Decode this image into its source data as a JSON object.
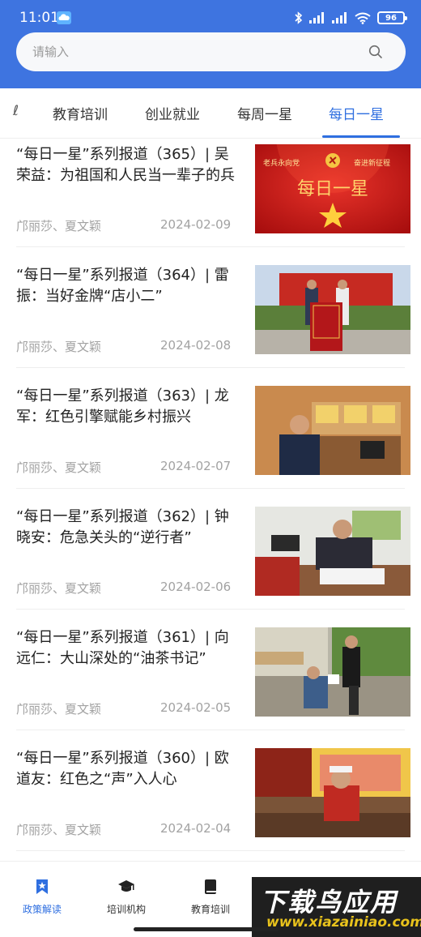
{
  "status": {
    "time": "11:01",
    "battery": "96"
  },
  "search": {
    "placeholder": "请输入",
    "value": ""
  },
  "tabs": [
    {
      "label": "ℓ",
      "active": false
    },
    {
      "label": "教育培训",
      "active": false
    },
    {
      "label": "创业就业",
      "active": false
    },
    {
      "label": "每周一星",
      "active": false
    },
    {
      "label": "每日一星",
      "active": true
    }
  ],
  "articles": [
    {
      "title": "“每日一星”系列报道（365）| 吴荣益：为祖国和人民当一辈子的兵",
      "author": "邝丽莎、夏文颖",
      "date": "2024-02-09",
      "thumb": {
        "banner_left": "老兵永向党",
        "banner_right": "奋进新征程",
        "headline": "每日一星"
      }
    },
    {
      "title": "“每日一星”系列报道（364）| 雷振：当好金牌“店小二”",
      "author": "邝丽莎、夏文颖",
      "date": "2024-02-08"
    },
    {
      "title": "“每日一星”系列报道（363）| 龙军：红色引擎赋能乡村振兴",
      "author": "邝丽莎、夏文颖",
      "date": "2024-02-07"
    },
    {
      "title": "“每日一星”系列报道（362）| 钟晓安：危急关头的“逆行者”",
      "author": "邝丽莎、夏文颖",
      "date": "2024-02-06"
    },
    {
      "title": "“每日一星”系列报道（361）| 向远仁：大山深处的“油茶书记”",
      "author": "邝丽莎、夏文颖",
      "date": "2024-02-05"
    },
    {
      "title": "“每日一星”系列报道（360）| 欧道友：红色之“声”入人心",
      "author": "邝丽莎、夏文颖",
      "date": "2024-02-04"
    }
  ],
  "bottom_nav": [
    {
      "label": "政策解读",
      "icon": "bookmark-star-icon",
      "active": true
    },
    {
      "label": "培训机构",
      "icon": "graduation-cap-icon",
      "active": false
    },
    {
      "label": "教育培训",
      "icon": "book-icon",
      "active": false
    }
  ],
  "watermark": {
    "title": "下载鸟应用",
    "url": "www.xiazainiao.com"
  },
  "colors": {
    "primary": "#3e74e0",
    "active_tab": "#2f6fe0",
    "meta_text": "#a2a2a2"
  }
}
